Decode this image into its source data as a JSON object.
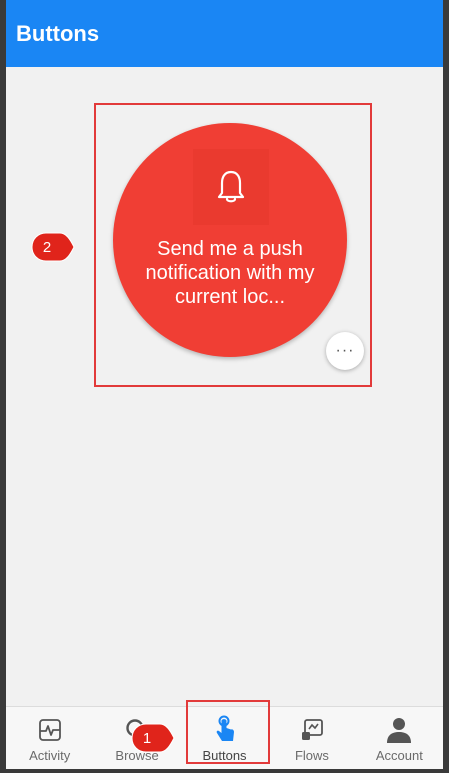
{
  "app_bar": {
    "title": "Buttons"
  },
  "flow_button": {
    "icon": "bell-icon",
    "label": "Send me a push notification with my current loc...",
    "color": "#f03e34",
    "more_label": "···"
  },
  "callouts": {
    "one": "1",
    "two": "2"
  },
  "bottom_nav": {
    "items": [
      {
        "label": "Activity",
        "icon": "activity-icon"
      },
      {
        "label": "Browse",
        "icon": "search-icon"
      },
      {
        "label": "Buttons",
        "icon": "touch-icon",
        "active": true
      },
      {
        "label": "Flows",
        "icon": "flows-icon"
      },
      {
        "label": "Account",
        "icon": "account-icon"
      }
    ]
  },
  "colors": {
    "app_bar": "#1a86f4",
    "accent": "#1a86f4",
    "highlight": "#e23a3a"
  }
}
